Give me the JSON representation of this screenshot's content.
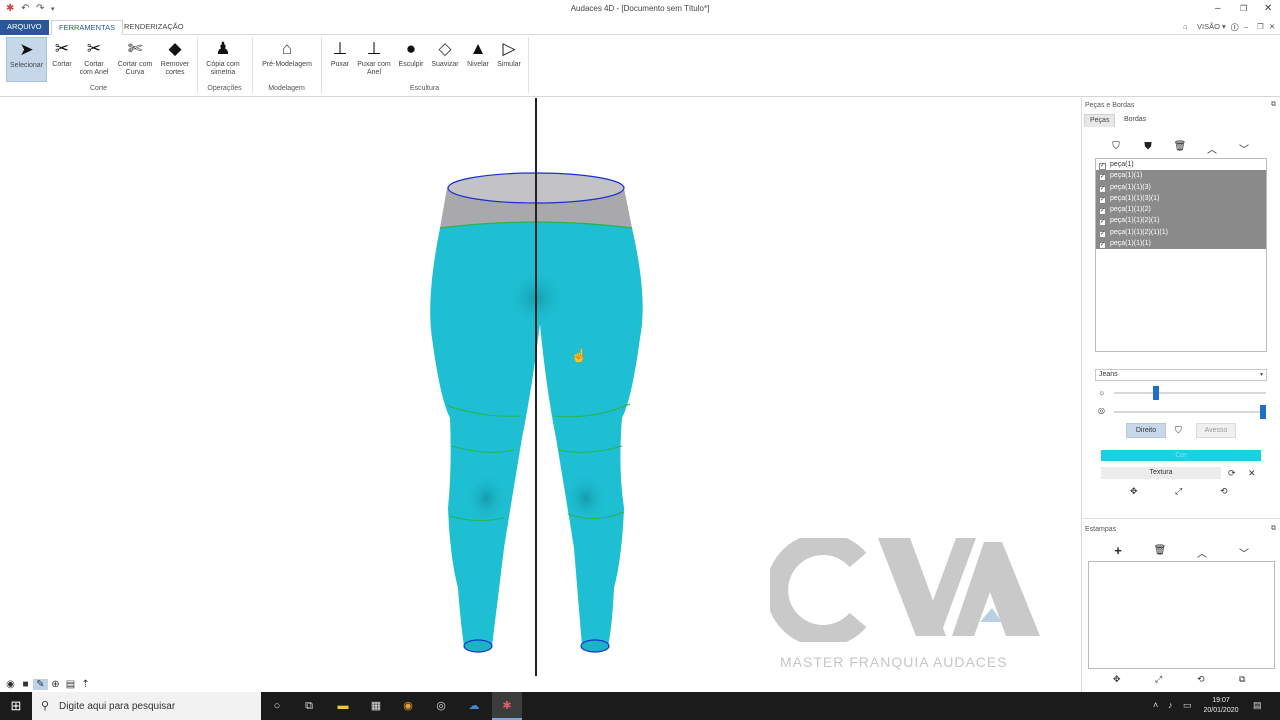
{
  "window": {
    "title": "Audaces 4D - [Documento sem Título*]"
  },
  "menu": {
    "tabs": [
      "ARQUIVO",
      "FERRAMENTAS",
      "RENDERIZAÇÃO"
    ],
    "view_label": "VISÃO"
  },
  "ribbon": {
    "buttons": [
      {
        "label": "Selecionar",
        "icon": "cursor-arrow-icon"
      },
      {
        "label": "Cortar",
        "icon": "scissors-icon"
      },
      {
        "label": "Cortar com Anel",
        "icon": "scissors-ring-icon"
      },
      {
        "label": "Cortar com Curva",
        "icon": "scissors-curve-icon"
      },
      {
        "label": "Remover cortes",
        "icon": "remove-cut-icon"
      },
      {
        "label": "Cópia com simetria",
        "icon": "symmetry-copy-icon"
      },
      {
        "label": "Pré-Modelagem",
        "icon": "premodel-icon"
      },
      {
        "label": "Puxar",
        "icon": "pull-icon"
      },
      {
        "label": "Puxar com Anel",
        "icon": "pull-ring-icon"
      },
      {
        "label": "Esculpir",
        "icon": "sculpt-icon"
      },
      {
        "label": "Suavizar",
        "icon": "smooth-icon"
      },
      {
        "label": "Nivelar",
        "icon": "level-icon"
      },
      {
        "label": "Simular",
        "icon": "play-icon"
      }
    ],
    "groups": [
      "Corte",
      "Operações",
      "Modelagem",
      "Escultura"
    ]
  },
  "panel": {
    "title": "Peças e Bordas",
    "tabs": [
      "Peças",
      "Bordas"
    ],
    "items": [
      {
        "label": "peça(1)",
        "checked": true,
        "selected": false
      },
      {
        "label": "peça(1)(1)",
        "checked": true,
        "selected": true
      },
      {
        "label": "peça(1)(1)(3)",
        "checked": true,
        "selected": true
      },
      {
        "label": "peça(1)(1)(3)(1)",
        "checked": true,
        "selected": true
      },
      {
        "label": "peça(1)(1)(2)",
        "checked": true,
        "selected": true
      },
      {
        "label": "peça(1)(1)(2)(1)",
        "checked": true,
        "selected": true
      },
      {
        "label": "peça(1)(1)(2)(1)(1)",
        "checked": true,
        "selected": true
      },
      {
        "label": "peça(1)(1)(1)",
        "checked": true,
        "selected": true
      }
    ],
    "material": "Jeans",
    "brightness_level": 0.27,
    "visibility_level": 1.0,
    "side_buttons": {
      "front": "Direito",
      "back": "Avesso"
    },
    "color_label": "Cor",
    "color_value": "#1bd0e3",
    "texture_label": "Textura"
  },
  "stamps": {
    "title": "Estampas"
  },
  "watermark": {
    "logo": "CVA",
    "subtitle": "MASTER FRANQUIA AUDACES"
  },
  "taskbar": {
    "search_placeholder": "Digite aqui para pesquisar",
    "time": "19:07",
    "date": "20/01/2020"
  },
  "colors": {
    "garment": "#1ebfd3",
    "waistband": "#a9a9ad",
    "seam": "#2ab34a",
    "outline": "#1a2fd0",
    "accent": "#2b579a"
  }
}
